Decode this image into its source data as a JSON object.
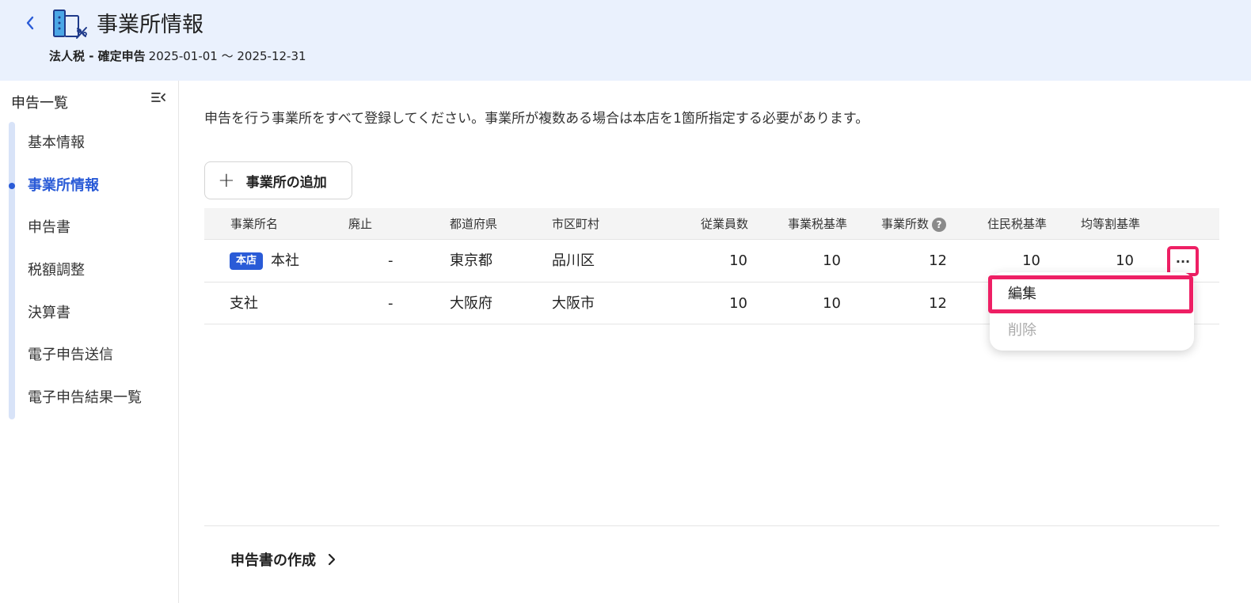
{
  "header": {
    "title": "事業所情報",
    "subtitle_bold": "法人税 - 確定申告",
    "period": "2025-01-01 〜 2025-12-31",
    "back_icon": "chevron-left-icon",
    "page_icon": "building-tax-icon",
    "accent_color": "#2a5bd7",
    "background_color": "#eaf1fd"
  },
  "sidebar": {
    "heading": "申告一覧",
    "collapse_icon": "collapse-menu-icon",
    "items": [
      {
        "label": "基本情報"
      },
      {
        "label": "事業所情報",
        "active": true
      },
      {
        "label": "申告書"
      },
      {
        "label": "税額調整"
      },
      {
        "label": "決算書"
      },
      {
        "label": "電子申告送信"
      },
      {
        "label": "電子申告結果一覧"
      }
    ]
  },
  "main": {
    "description": "申告を行う事業所をすべて登録してください。事業所が複数ある場合は本店を1箇所指定する必要があります。",
    "add_button_label": "事業所の追加",
    "table": {
      "headers": [
        "事業所名",
        "廃止",
        "都道府県",
        "市区町村",
        "従業員数",
        "事業税基準",
        "事業所数",
        "住民税基準",
        "均等割基準"
      ],
      "rows": [
        {
          "badge": "本店",
          "name": "本社",
          "abolished": "-",
          "prefecture": "東京都",
          "city": "品川区",
          "employees": "10",
          "business_tax": "10",
          "offices": "12",
          "resident_tax": "10",
          "per_capita": "10"
        },
        {
          "badge": "",
          "name": "支社",
          "abolished": "-",
          "prefecture": "大阪府",
          "city": "大阪市",
          "employees": "10",
          "business_tax": "10",
          "offices": "12",
          "resident_tax": "",
          "per_capita": ""
        }
      ]
    },
    "row_menu": {
      "more_label": "···",
      "edit_label": "編集",
      "delete_label": "削除"
    },
    "footer_link": "申告書の作成",
    "highlight_color": "#ee1f64"
  }
}
